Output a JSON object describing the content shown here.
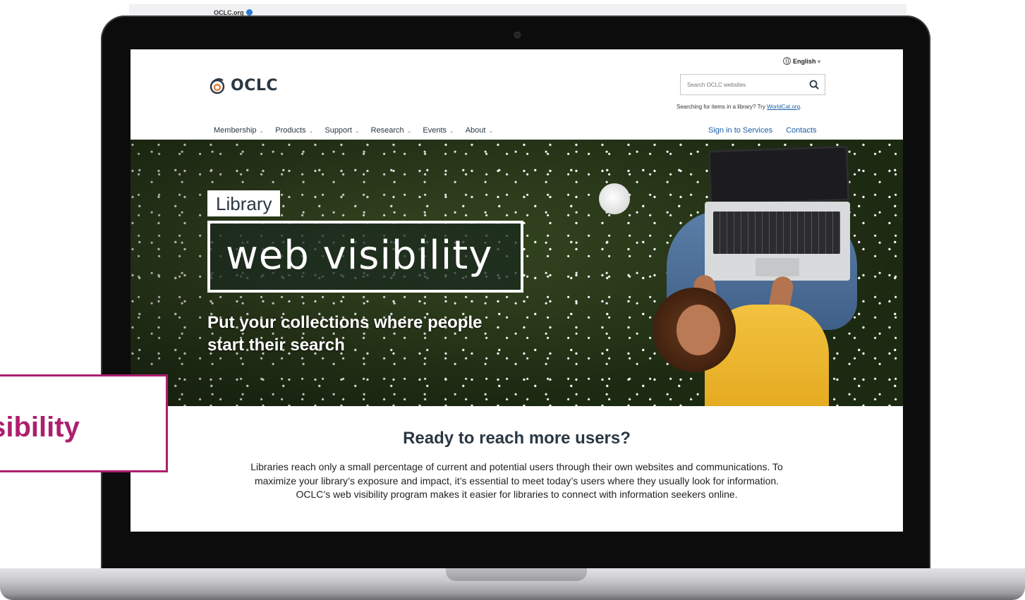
{
  "browser": {
    "url": "OCLC.org"
  },
  "header": {
    "language": "English",
    "logo": "OCLC",
    "search_placeholder": "Search OCLC websites",
    "search_hint_prefix": "Searching for items in a library? Try",
    "search_hint_link": "WorldCat.org",
    "search_hint_suffix": "."
  },
  "nav": {
    "items": [
      {
        "label": "Membership"
      },
      {
        "label": "Products"
      },
      {
        "label": "Support"
      },
      {
        "label": "Research"
      },
      {
        "label": "Events"
      },
      {
        "label": "About"
      }
    ],
    "sign_in": "Sign in to Services",
    "contacts": "Contacts"
  },
  "hero": {
    "kicker": "Library",
    "title": "web visibility",
    "subtitle": "Put your collections where people start their search"
  },
  "main": {
    "heading": "Ready to reach more users?",
    "body": "Libraries reach only a small percentage of current and potential users through their own websites and communications. To maximize your library’s exposure and impact, it’s essential to meet today’s users where they usually look for information. OCLC’s web visibility program makes it easier for libraries to connect with information seekers online."
  },
  "callout": {
    "text": "isibility"
  },
  "colors": {
    "accent": "#ad1f6d",
    "link": "#1a5ea8",
    "navy": "#2b3844"
  }
}
